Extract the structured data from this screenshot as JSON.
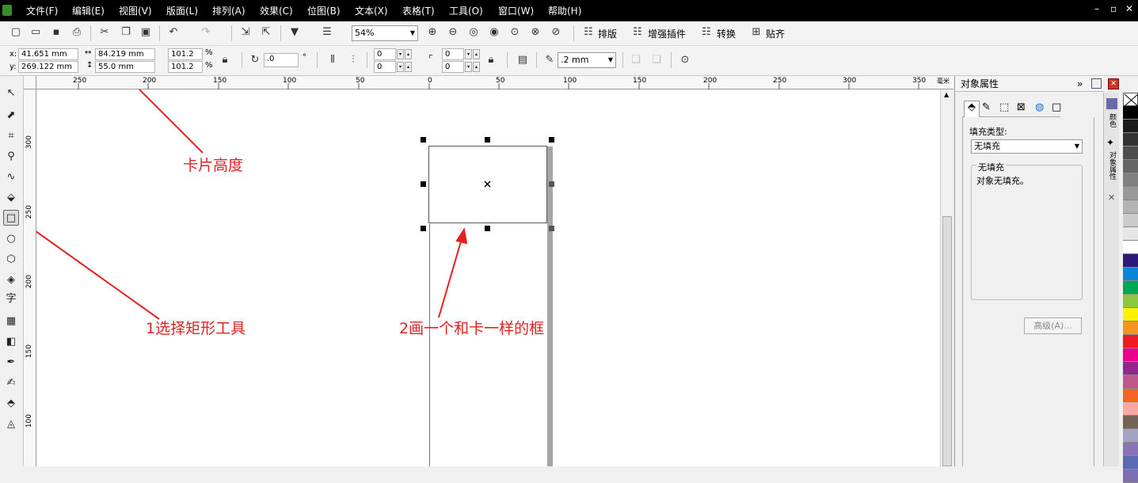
{
  "menu": [
    "文件(F)",
    "编辑(E)",
    "视图(V)",
    "版面(L)",
    "排列(A)",
    "效果(C)",
    "位图(B)",
    "文本(X)",
    "表格(T)",
    "工具(O)",
    "窗口(W)",
    "帮助(H)"
  ],
  "window_controls": {
    "minimize": "–",
    "restore": "▫",
    "close": "✕"
  },
  "toolbar": {
    "zoom_value": "54%",
    "layout_label": "排版",
    "plugins_label": "增强插件",
    "convert_label": "转换",
    "align_label": "贴齐"
  },
  "property_bar": {
    "x_label": "x:",
    "x_value": "41.651 mm",
    "y_label": "y:",
    "y_value": "269.122 mm",
    "width_value": "84.219 mm",
    "height_value": "55.0 mm",
    "scale_x": "101.2",
    "scale_y": "101.2",
    "percent": "%",
    "rotation": ".0",
    "degree": "°",
    "corner_tl": "0",
    "corner_bl": "0",
    "corner_tr": "0",
    "corner_br": "0",
    "outline_width": ".2 mm"
  },
  "ruler": {
    "h_labels": [
      "250",
      "200",
      "150",
      "100",
      "50",
      "0",
      "50",
      "100",
      "150",
      "200",
      "250",
      "300",
      "350"
    ],
    "h_unit": "毫米",
    "v_labels": [
      "300",
      "250",
      "200",
      "150",
      "100"
    ]
  },
  "panel": {
    "title": "对象属性",
    "fill_type_label": "填充类型:",
    "fill_type_value": "无填充",
    "group_title": "无填充",
    "group_text": "对象无填充。",
    "advanced_button": "高级(A)..."
  },
  "docker_tabs": [
    "颜色",
    "对象属性"
  ],
  "palette_colors": [
    "#ffffff",
    "#000000",
    "#1a1a1a",
    "#333333",
    "#4d4d4d",
    "#666666",
    "#808080",
    "#999999",
    "#b3b3b3",
    "#cccccc",
    "#e6e6e6",
    "#ffffff",
    "#2e1a7a",
    "#0a86d8",
    "#00a651",
    "#8dc63f",
    "#fff200",
    "#f7941d",
    "#ed1c24",
    "#ec008c",
    "#92278f",
    "#c0568a",
    "#f26522",
    "#f7a9a0",
    "#736357",
    "#a3a3c2",
    "#8b74b5",
    "#5b6bb5",
    "#7f6fb2"
  ],
  "annotations": {
    "card_height": "卡片高度",
    "select_rect": "1选择矩形工具",
    "draw_box": "2画一个和卡一样的框"
  },
  "accent_color": "#e32121"
}
